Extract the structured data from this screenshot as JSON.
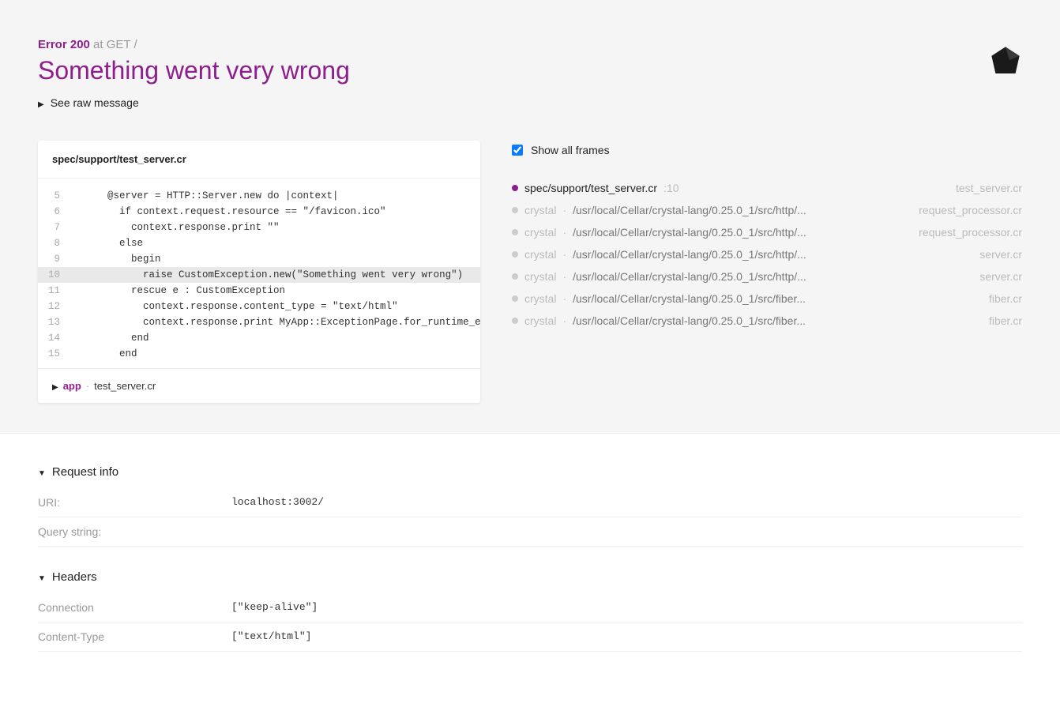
{
  "header": {
    "error_code": "Error 200",
    "context": "at GET /",
    "title": "Something went very wrong",
    "raw_message_toggle": "See raw message"
  },
  "code": {
    "file": "spec/support/test_server.cr",
    "highlight_line": 10,
    "lines": [
      {
        "no": 5,
        "text": "    @server = HTTP::Server.new do |context|"
      },
      {
        "no": 6,
        "text": "      if context.request.resource == \"/favicon.ico\""
      },
      {
        "no": 7,
        "text": "        context.response.print \"\""
      },
      {
        "no": 8,
        "text": "      else"
      },
      {
        "no": 9,
        "text": "        begin"
      },
      {
        "no": 10,
        "text": "          raise CustomException.new(\"Something went very wrong\")"
      },
      {
        "no": 11,
        "text": "        rescue e : CustomException"
      },
      {
        "no": 12,
        "text": "          context.response.content_type = \"text/html\""
      },
      {
        "no": 13,
        "text": "          context.response.print MyApp::ExceptionPage.for_runtime_excep"
      },
      {
        "no": 14,
        "text": "        end"
      },
      {
        "no": 15,
        "text": "      end"
      }
    ],
    "footer_app": "app",
    "footer_file": "test_server.cr"
  },
  "frames": {
    "show_all_label": "Show all frames",
    "show_all_checked": true,
    "items": [
      {
        "active": true,
        "label": "spec/support/test_server.cr",
        "line": ":10",
        "file": "test_server.cr"
      },
      {
        "active": false,
        "crystal": "crystal",
        "path": "/usr/local/Cellar/crystal-lang/0.25.0_1/src/http/...",
        "file": "request_processor.cr"
      },
      {
        "active": false,
        "crystal": "crystal",
        "path": "/usr/local/Cellar/crystal-lang/0.25.0_1/src/http/...",
        "file": "request_processor.cr"
      },
      {
        "active": false,
        "crystal": "crystal",
        "path": "/usr/local/Cellar/crystal-lang/0.25.0_1/src/http/...",
        "file": "server.cr"
      },
      {
        "active": false,
        "crystal": "crystal",
        "path": "/usr/local/Cellar/crystal-lang/0.25.0_1/src/http/...",
        "file": "server.cr"
      },
      {
        "active": false,
        "crystal": "crystal",
        "path": "/usr/local/Cellar/crystal-lang/0.25.0_1/src/fiber...",
        "file": "fiber.cr"
      },
      {
        "active": false,
        "crystal": "crystal",
        "path": "/usr/local/Cellar/crystal-lang/0.25.0_1/src/fiber...",
        "file": "fiber.cr"
      }
    ]
  },
  "request_info": {
    "heading": "Request info",
    "rows": [
      {
        "key": "URI:",
        "value": "localhost:3002/"
      },
      {
        "key": "Query string:",
        "value": ""
      }
    ]
  },
  "headers": {
    "heading": "Headers",
    "rows": [
      {
        "key": "Connection",
        "value": "[\"keep-alive\"]"
      },
      {
        "key": "Content-Type",
        "value": "[\"text/html\"]"
      }
    ]
  }
}
